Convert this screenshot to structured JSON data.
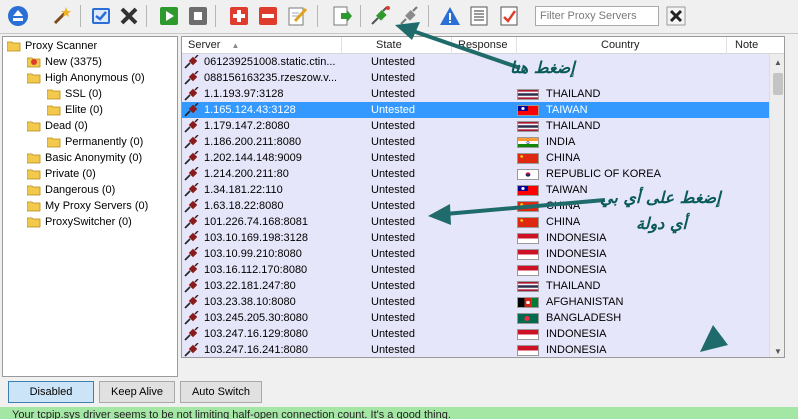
{
  "toolbar": {
    "filter_placeholder": "Filter Proxy Servers",
    "buttons": [
      "eject-icon",
      "wand-icon",
      "check-box-icon",
      "close-icon",
      "play-icon",
      "stop-icon",
      "add-icon",
      "remove-icon",
      "edit-icon",
      "export-icon",
      "connect-icon",
      "disconnect-icon",
      "warning-icon",
      "list-icon",
      "report-icon"
    ],
    "colors": {
      "blue": "#2b6fd6",
      "green": "#2e9a2e",
      "red": "#e03c2d"
    }
  },
  "tree": [
    {
      "label": "Proxy Scanner",
      "level": 0,
      "icon": "open-folder-icon"
    },
    {
      "label": "New (3375)",
      "level": 1,
      "icon": "new-folder-icon"
    },
    {
      "label": "High Anonymous (0)",
      "level": 1,
      "icon": "folder-icon"
    },
    {
      "label": "SSL (0)",
      "level": 2,
      "icon": "folder-icon"
    },
    {
      "label": "Elite (0)",
      "level": 2,
      "icon": "folder-icon"
    },
    {
      "label": "Dead (0)",
      "level": 1,
      "icon": "folder-icon"
    },
    {
      "label": "Permanently (0)",
      "level": 2,
      "icon": "folder-icon"
    },
    {
      "label": "Basic Anonymity (0)",
      "level": 1,
      "icon": "folder-icon"
    },
    {
      "label": "Private (0)",
      "level": 1,
      "icon": "folder-icon"
    },
    {
      "label": "Dangerous (0)",
      "level": 1,
      "icon": "folder-icon"
    },
    {
      "label": "My Proxy Servers (0)",
      "level": 1,
      "icon": "folder-icon"
    },
    {
      "label": "ProxySwitcher (0)",
      "level": 1,
      "icon": "folder-icon"
    }
  ],
  "table": {
    "columns": [
      "Server",
      "State",
      "Response",
      "Country",
      "Note"
    ],
    "sort_indicator": "▲",
    "rows": [
      {
        "server": "06123925​1008.static.ctin...",
        "state": "Untested",
        "country": "",
        "flag": ""
      },
      {
        "server": "08815616​3235.rzeszow.v...",
        "state": "Untested",
        "country": "",
        "flag": ""
      },
      {
        "server": "1.1.193.97:3128",
        "state": "Untested",
        "country": "THAILAND",
        "flag": "th"
      },
      {
        "server": "1.165.124.43:3128",
        "state": "Untested",
        "country": "TAIWAN",
        "flag": "tw",
        "selected": true
      },
      {
        "server": "1.179.147.2:8080",
        "state": "Untested",
        "country": "THAILAND",
        "flag": "th"
      },
      {
        "server": "1.186.200.211:8080",
        "state": "Untested",
        "country": "INDIA",
        "flag": "in"
      },
      {
        "server": "1.202.144.148:9009",
        "state": "Untested",
        "country": "CHINA",
        "flag": "cn"
      },
      {
        "server": "1.214.200.211:80",
        "state": "Untested",
        "country": "REPUBLIC OF KOREA",
        "flag": "kr"
      },
      {
        "server": "1.34.181.22:110",
        "state": "Untested",
        "country": "TAIWAN",
        "flag": "tw"
      },
      {
        "server": "1.63.18.22:8080",
        "state": "Untested",
        "country": "CHINA",
        "flag": "cn"
      },
      {
        "server": "101.226.74.168:8081",
        "state": "Untested",
        "country": "CHINA",
        "flag": "cn"
      },
      {
        "server": "103.10.169.198:3128",
        "state": "Untested",
        "country": "INDONESIA",
        "flag": "id"
      },
      {
        "server": "103.10.99.210:8080",
        "state": "Untested",
        "country": "INDONESIA",
        "flag": "id"
      },
      {
        "server": "103.16.112.170:8080",
        "state": "Untested",
        "country": "INDONESIA",
        "flag": "id"
      },
      {
        "server": "103.22.181.247:80",
        "state": "Untested",
        "country": "THAILAND",
        "flag": "th"
      },
      {
        "server": "103.23.38.10:8080",
        "state": "Untested",
        "country": "AFGHANISTAN",
        "flag": "af"
      },
      {
        "server": "103.245.205.30:8080",
        "state": "Untested",
        "country": "BANGLADESH",
        "flag": "bd"
      },
      {
        "server": "103.247.16.129:8080",
        "state": "Untested",
        "country": "INDONESIA",
        "flag": "id"
      },
      {
        "server": "103.247.16.241:8080",
        "state": "Untested",
        "country": "INDONESIA",
        "flag": "id"
      }
    ]
  },
  "bottom_buttons": [
    "Disabled",
    "Keep Alive",
    "Auto Switch"
  ],
  "status": "Your tcpip.sys driver seems to be not limiting half-open connection count.  It's a good thing.",
  "annotations": {
    "click_here": "إضغط هنا",
    "click_country_line1": "إضغط على أي بي",
    "click_country_line2": "أي دولة",
    "arrow_color": "#1f6b6b"
  }
}
